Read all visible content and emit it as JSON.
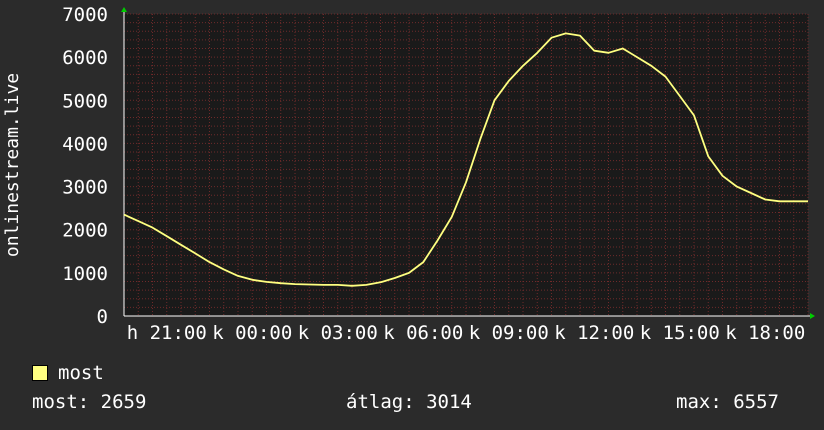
{
  "chart_data": {
    "type": "line",
    "ylabel": "onlinestream.live",
    "ylim": [
      0,
      7000
    ],
    "yticks": [
      0,
      1000,
      2000,
      3000,
      4000,
      5000,
      6000,
      7000
    ],
    "xlim": [
      -1.5,
      22.5
    ],
    "xticks": [
      {
        "x": 0,
        "label": "h 21:00"
      },
      {
        "x": 3,
        "label": "k 00:00"
      },
      {
        "x": 6,
        "label": "k 03:00"
      },
      {
        "x": 9,
        "label": "k 06:00"
      },
      {
        "x": 12,
        "label": "k 09:00"
      },
      {
        "x": 15,
        "label": "k 12:00"
      },
      {
        "x": 18,
        "label": "k 15:00"
      },
      {
        "x": 21,
        "label": "k 18:00"
      }
    ],
    "grid": true,
    "colors": {
      "background": "#2b2b2b",
      "plot_bg": "#1a1a1a",
      "grid": "#6e2a2a",
      "line": "#ffff80",
      "axis_arrow": "#00cc00",
      "text": "#ffffff"
    },
    "series": [
      {
        "name": "most",
        "color": "#ffff80",
        "x": [
          -1.5,
          -1.0,
          -0.5,
          0.0,
          0.5,
          1.0,
          1.5,
          2.0,
          2.5,
          3.0,
          3.5,
          4.0,
          4.5,
          5.0,
          5.5,
          6.0,
          6.5,
          7.0,
          7.5,
          8.0,
          8.5,
          9.0,
          9.5,
          10.0,
          10.5,
          11.0,
          11.5,
          12.0,
          12.5,
          13.0,
          13.5,
          14.0,
          14.5,
          15.0,
          15.5,
          16.0,
          16.5,
          17.0,
          17.5,
          18.0,
          18.5,
          19.0,
          19.5,
          20.0,
          20.5,
          21.0,
          21.5,
          22.0,
          22.5
        ],
        "y": [
          2350,
          2200,
          2050,
          1850,
          1650,
          1450,
          1250,
          1080,
          930,
          840,
          790,
          760,
          740,
          730,
          720,
          720,
          700,
          720,
          780,
          880,
          1000,
          1250,
          1750,
          2300,
          3100,
          4100,
          5000,
          5450,
          5800,
          6100,
          6450,
          6550,
          6500,
          6150,
          6100,
          6200,
          6000,
          5800,
          5550,
          5100,
          4650,
          3700,
          3250,
          3000,
          2850,
          2700,
          2659,
          2659,
          2659
        ]
      }
    ]
  },
  "legend": {
    "label": "most",
    "color": "#ffff80"
  },
  "stats": {
    "current": "most: 2659",
    "average": "átlag: 3014",
    "max": "max: 6557"
  }
}
